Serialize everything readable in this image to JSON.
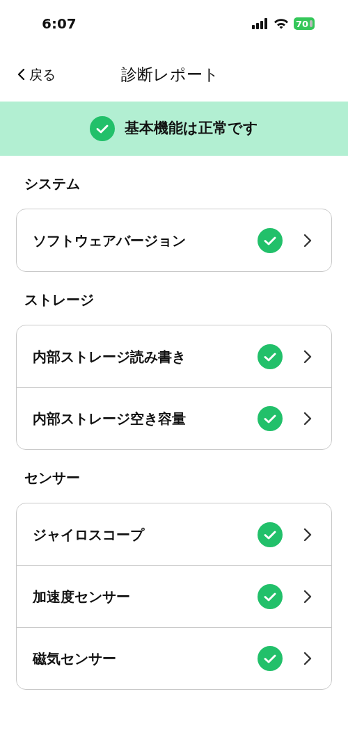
{
  "status_bar": {
    "time": "6:07",
    "battery": "70"
  },
  "nav": {
    "back": "戻る",
    "title": "診断レポート"
  },
  "banner": {
    "passed": true,
    "text": "基本機能は正常です"
  },
  "sections": [
    {
      "title": "システム",
      "items": [
        {
          "label": "ソフトウェアバージョン",
          "passed": true
        }
      ]
    },
    {
      "title": "ストレージ",
      "items": [
        {
          "label": "内部ストレージ読み書き",
          "passed": true
        },
        {
          "label": "内部ストレージ空き容量",
          "passed": true
        }
      ]
    },
    {
      "title": "センサー",
      "items": [
        {
          "label": "ジャイロスコープ",
          "passed": true
        },
        {
          "label": "加速度センサー",
          "passed": true
        },
        {
          "label": "磁気センサー",
          "passed": true
        }
      ]
    }
  ]
}
